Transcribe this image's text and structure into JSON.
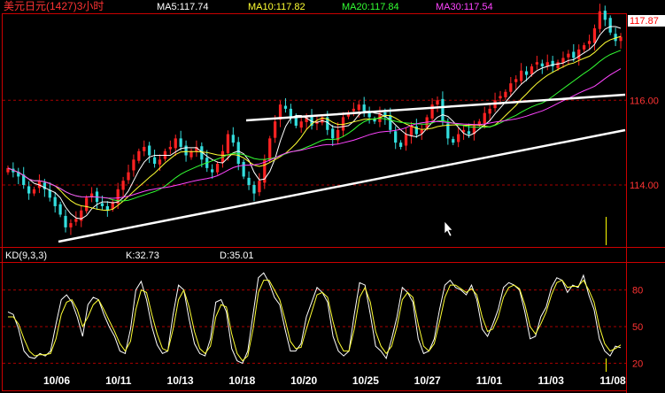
{
  "header": {
    "title": "美元日元(1427)3小时",
    "ma5": "MA5:117.74",
    "ma10": "MA10:117.82",
    "ma20": "MA20:117.84",
    "ma30": "MA30:117.54"
  },
  "kd_header": {
    "label": "KD(9,3,3)",
    "k": "K:32.73",
    "d": "D:35.01"
  },
  "last_price_label": "117.87",
  "colors": {
    "background": "#000000",
    "frame": "#cc0000",
    "up_candle": "#ff2222",
    "down_candle": "#33dddd",
    "ma5": "#ffffff",
    "ma10": "#ffff33",
    "ma20": "#33ff33",
    "ma30": "#ff44ff",
    "trend_line": "#ffffff"
  },
  "chart_data": [
    {
      "type": "candlestick",
      "title": "美元日元(1427)3小时",
      "x_tick_labels": [
        "10/06",
        "10/11",
        "10/13",
        "10/18",
        "10/20",
        "10/25",
        "10/27",
        "11/01",
        "11/03",
        "11/08"
      ],
      "y_tick_labels": [
        "114.00",
        "116.00"
      ],
      "ylim": [
        112.6,
        117.95
      ],
      "grid": "horizontal dashed",
      "last_price": 117.87,
      "series": [
        {
          "name": "MA5",
          "last": 117.74
        },
        {
          "name": "MA10",
          "last": 117.82
        },
        {
          "name": "MA20",
          "last": 117.84
        },
        {
          "name": "MA30",
          "last": 117.54
        }
      ],
      "close": [
        114.4,
        114.3,
        114.2,
        114.0,
        113.8,
        113.9,
        114.1,
        113.9,
        113.7,
        113.5,
        113.3,
        113.0,
        113.1,
        113.2,
        113.4,
        113.7,
        113.8,
        113.6,
        113.5,
        113.4,
        113.6,
        113.9,
        114.1,
        114.3,
        114.6,
        114.8,
        114.9,
        114.7,
        114.5,
        114.6,
        114.8,
        114.9,
        115.1,
        114.9,
        114.7,
        114.8,
        114.9,
        114.6,
        114.4,
        114.3,
        114.5,
        114.8,
        115.2,
        115.0,
        114.5,
        114.2,
        114.0,
        113.8,
        114.1,
        114.6,
        115.1,
        115.5,
        115.9,
        115.8,
        115.6,
        115.4,
        115.5,
        115.6,
        115.4,
        115.5,
        115.6,
        115.3,
        115.1,
        115.3,
        115.6,
        115.7,
        115.8,
        115.9,
        115.7,
        115.6,
        115.5,
        115.7,
        115.6,
        115.3,
        115.0,
        114.9,
        115.2,
        115.4,
        115.2,
        115.3,
        115.6,
        115.9,
        116.0,
        115.5,
        115.1,
        115.0,
        115.2,
        115.3,
        115.2,
        115.4,
        115.5,
        115.7,
        115.8,
        116.0,
        116.1,
        116.2,
        116.4,
        116.5,
        116.7,
        116.6,
        116.8,
        116.9,
        116.8,
        116.9,
        116.8,
        116.9,
        117.0,
        117.1,
        117.0,
        117.2,
        117.3,
        117.4,
        117.7,
        118.1,
        117.9,
        117.6,
        117.4,
        117.5
      ]
    },
    {
      "type": "line",
      "title": "KD(9,3,3)",
      "y_tick_labels": [
        "20",
        "50",
        "80"
      ],
      "ylim": [
        0,
        100
      ],
      "x_tick_labels": [
        "10/06",
        "10/11",
        "10/13",
        "10/18",
        "10/20",
        "10/25",
        "10/27",
        "11/01",
        "11/03",
        "11/08"
      ],
      "series": [
        {
          "name": "K",
          "last": 32.73,
          "values": [
            62,
            60,
            48,
            30,
            25,
            24,
            28,
            26,
            30,
            52,
            72,
            76,
            70,
            58,
            42,
            68,
            74,
            72,
            60,
            50,
            42,
            30,
            28,
            48,
            80,
            87,
            72,
            50,
            35,
            28,
            30,
            60,
            84,
            80,
            56,
            36,
            28,
            26,
            40,
            70,
            72,
            62,
            32,
            22,
            20,
            30,
            60,
            90,
            94,
            86,
            74,
            68,
            48,
            30,
            30,
            36,
            58,
            70,
            82,
            78,
            70,
            42,
            30,
            26,
            30,
            60,
            86,
            84,
            60,
            34,
            30,
            24,
            40,
            58,
            82,
            78,
            70,
            40,
            28,
            30,
            40,
            64,
            84,
            88,
            82,
            80,
            76,
            84,
            72,
            48,
            42,
            52,
            64,
            82,
            86,
            84,
            80,
            62,
            40,
            42,
            58,
            66,
            82,
            90,
            88,
            78,
            84,
            82,
            92,
            76,
            64,
            40,
            30,
            26,
            34,
            32.73
          ]
        },
        {
          "name": "D",
          "last": 35.01,
          "values": [
            58,
            58,
            52,
            40,
            30,
            26,
            27,
            27,
            28,
            40,
            60,
            70,
            72,
            64,
            50,
            58,
            68,
            72,
            64,
            55,
            46,
            36,
            30,
            38,
            64,
            80,
            78,
            60,
            44,
            32,
            30,
            48,
            72,
            80,
            66,
            46,
            32,
            28,
            34,
            58,
            68,
            66,
            44,
            28,
            22,
            26,
            48,
            78,
            88,
            88,
            80,
            72,
            56,
            38,
            32,
            33,
            48,
            62,
            76,
            78,
            74,
            54,
            38,
            30,
            30,
            48,
            74,
            82,
            70,
            46,
            34,
            28,
            34,
            50,
            72,
            78,
            74,
            52,
            34,
            30,
            36,
            54,
            74,
            84,
            84,
            81,
            78,
            81,
            76,
            58,
            46,
            48,
            58,
            74,
            82,
            84,
            81,
            68,
            50,
            44,
            52,
            62,
            76,
            86,
            88,
            82,
            83,
            83,
            88,
            80,
            70,
            50,
            36,
            30,
            32,
            35.01
          ]
        }
      ]
    }
  ]
}
